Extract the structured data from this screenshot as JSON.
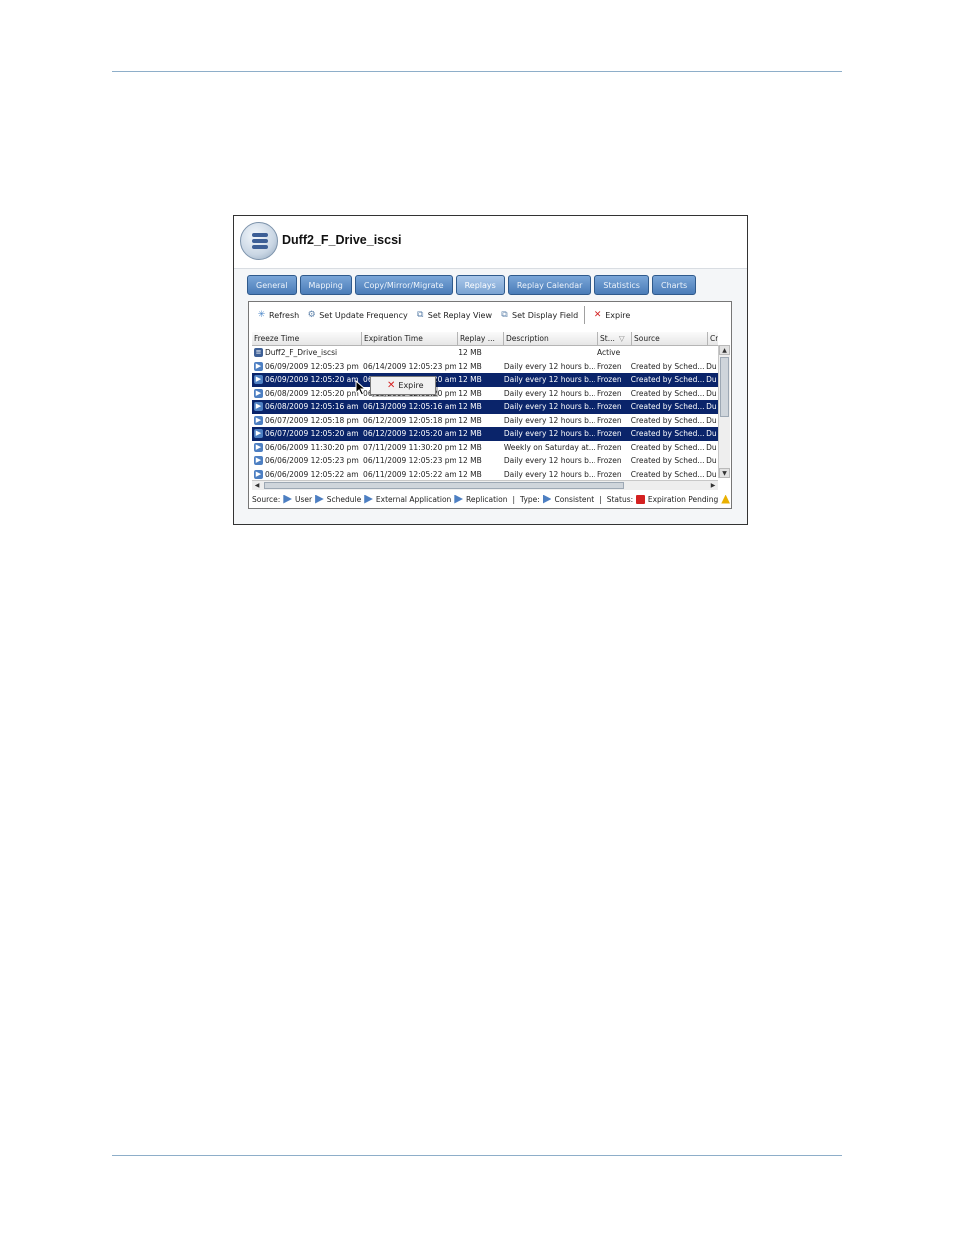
{
  "window": {
    "title": "Duff2_F_Drive_iscsi",
    "icon": "storage-volume-icon"
  },
  "tabs": [
    "General",
    "Mapping",
    "Copy/Mirror/Migrate",
    "Replays",
    "Replay Calendar",
    "Statistics",
    "Charts"
  ],
  "active_tab": "Replays",
  "toolbar": {
    "refresh": "Refresh",
    "set_update_frequency": "Set Update Frequency",
    "set_replay_view": "Set Replay View",
    "set_display_field": "Set Display Field",
    "expire": "Expire"
  },
  "table": {
    "columns": [
      "Freeze Time",
      "Expiration Time",
      "Replay ...",
      "Description",
      "St...",
      "Source",
      "Cr"
    ],
    "rows": [
      {
        "freeze": "Duff2_F_Drive_iscsi",
        "expiration": "",
        "size": "12 MB",
        "description": "",
        "status": "Active",
        "source": "",
        "cr": "",
        "selected": false,
        "icon": "volume-icon"
      },
      {
        "freeze": "06/09/2009 12:05:23 pm",
        "expiration": "06/14/2009 12:05:23 pm",
        "size": "12 MB",
        "description": "Daily every 12 hours b...",
        "status": "Frozen",
        "source": "Created by Sched...",
        "cr": "Du",
        "selected": false,
        "icon": "schedule-replay-icon"
      },
      {
        "freeze": "06/09/2009 12:05:20 am",
        "expiration": "06/14/2009 12:05:20 am",
        "size": "12 MB",
        "description": "Daily every 12 hours b...",
        "status": "Frozen",
        "source": "Created by Sched...",
        "cr": "Du",
        "selected": true,
        "icon": "schedule-replay-icon"
      },
      {
        "freeze": "06/08/2009 12:05:20 pm",
        "expiration": "06/13/2009 12:05:20 pm",
        "size": "12 MB",
        "description": "Daily every 12 hours b...",
        "status": "Frozen",
        "source": "Created by Sched...",
        "cr": "Du",
        "selected": false,
        "icon": "schedule-replay-icon"
      },
      {
        "freeze": "06/08/2009 12:05:16 am",
        "expiration": "06/13/2009 12:05:16 am",
        "size": "12 MB",
        "description": "Daily every 12 hours b...",
        "status": "Frozen",
        "source": "Created by Sched...",
        "cr": "Du",
        "selected": true,
        "icon": "schedule-replay-icon"
      },
      {
        "freeze": "06/07/2009 12:05:18 pm",
        "expiration": "06/12/2009 12:05:18 pm",
        "size": "12 MB",
        "description": "Daily every 12 hours b...",
        "status": "Frozen",
        "source": "Created by Sched...",
        "cr": "Du",
        "selected": false,
        "icon": "schedule-replay-icon"
      },
      {
        "freeze": "06/07/2009 12:05:20 am",
        "expiration": "06/12/2009 12:05:20 am",
        "size": "12 MB",
        "description": "Daily every 12 hours b...",
        "status": "Frozen",
        "source": "Created by Sched...",
        "cr": "Du",
        "selected": true,
        "icon": "schedule-replay-icon"
      },
      {
        "freeze": "06/06/2009 11:30:20 pm",
        "expiration": "07/11/2009 11:30:20 pm",
        "size": "12 MB",
        "description": "Weekly on Saturday at...",
        "status": "Frozen",
        "source": "Created by Sched...",
        "cr": "Du",
        "selected": false,
        "icon": "schedule-replay-icon"
      },
      {
        "freeze": "06/06/2009 12:05:23 pm",
        "expiration": "06/11/2009 12:05:23 pm",
        "size": "12 MB",
        "description": "Daily every 12 hours b...",
        "status": "Frozen",
        "source": "Created by Sched...",
        "cr": "Du",
        "selected": false,
        "icon": "schedule-replay-icon"
      },
      {
        "freeze": "06/06/2009 12:05:22 am",
        "expiration": "06/11/2009 12:05:22 am",
        "size": "12 MB",
        "description": "Daily every 12 hours b...",
        "status": "Frozen",
        "source": "Created by Sched...",
        "cr": "Du",
        "selected": false,
        "icon": "schedule-replay-icon"
      }
    ]
  },
  "context_menu": {
    "expire": "Expire"
  },
  "legend": {
    "source_label": "Source:",
    "user": "User",
    "schedule": "Schedule",
    "external_application": "External Application",
    "replication": "Replication",
    "type_label": "Type:",
    "consistent": "Consistent",
    "status_label": "Status:",
    "expiration_pending": "Expiration Pending"
  },
  "colors": {
    "selection": "#0a246a",
    "tab_blue": "#4a7cb8",
    "rule": "#8eaec9"
  }
}
